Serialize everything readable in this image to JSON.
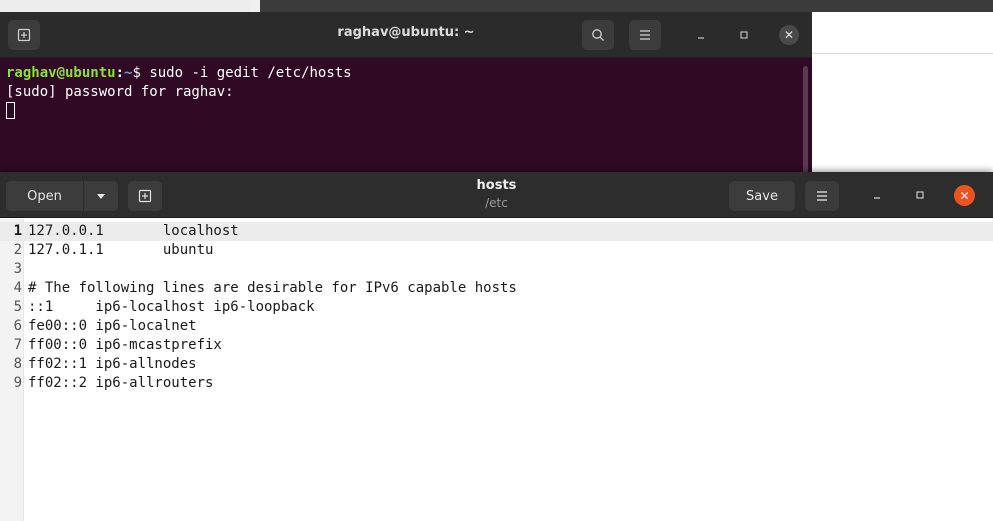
{
  "terminal": {
    "title": "raghav@ubuntu: ~",
    "icons": {
      "new_tab": "new-tab-icon",
      "search": "search-icon",
      "menu": "hamburger-menu-icon",
      "minimize": "minimize-icon",
      "maximize": "maximize-icon",
      "close": "close-icon"
    },
    "lines": {
      "prompt_user": "raghav@ubuntu",
      "prompt_sep": ":",
      "prompt_path": "~",
      "prompt_symbol": "$ ",
      "command": "sudo -i gedit /etc/hosts",
      "password_prompt": "[sudo] password for raghav:"
    }
  },
  "gedit": {
    "open_label": "Open",
    "save_label": "Save",
    "title": "hosts",
    "subtitle": "/etc",
    "icons": {
      "open_dropdown": "chevron-down-icon",
      "new_tab": "new-tab-icon",
      "menu": "hamburger-menu-icon",
      "minimize": "minimize-icon",
      "maximize": "maximize-icon",
      "close": "close-icon"
    },
    "accent_close": "#e95420",
    "current_line": 1,
    "lines": [
      {
        "n": "1",
        "text": "127.0.0.1       localhost"
      },
      {
        "n": "2",
        "text": "127.0.1.1       ubuntu"
      },
      {
        "n": "3",
        "text": ""
      },
      {
        "n": "4",
        "text": "# The following lines are desirable for IPv6 capable hosts"
      },
      {
        "n": "5",
        "text": "::1     ip6-localhost ip6-loopback"
      },
      {
        "n": "6",
        "text": "fe00::0 ip6-localnet"
      },
      {
        "n": "7",
        "text": "ff00::0 ip6-mcastprefix"
      },
      {
        "n": "8",
        "text": "ff02::1 ip6-allnodes"
      },
      {
        "n": "9",
        "text": "ff02::2 ip6-allrouters"
      }
    ]
  },
  "colors": {
    "terminal_bg": "#300a24",
    "header_bg": "#2d2d2d",
    "prompt_user": "#8ae234",
    "prompt_path": "#729fcf"
  }
}
